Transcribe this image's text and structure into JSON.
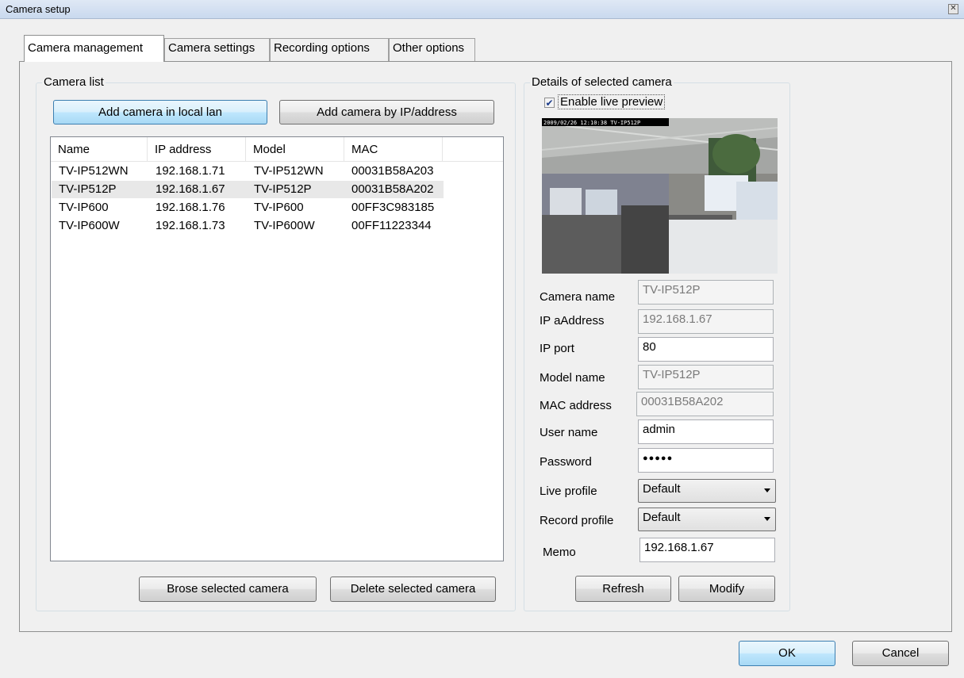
{
  "window": {
    "title": "Camera setup"
  },
  "tabs": [
    "Camera management",
    "Camera settings",
    "Recording options",
    "Other options"
  ],
  "camera_list": {
    "label": "Camera list",
    "add_local_button": "Add camera in local lan",
    "add_ip_button": "Add camera by IP/address",
    "columns": [
      "Name",
      "IP address",
      "Model",
      "MAC"
    ],
    "rows": [
      [
        "TV-IP512WN",
        "192.168.1.71",
        "TV-IP512WN",
        "00031B58A203"
      ],
      [
        "TV-IP512P",
        "192.168.1.67",
        "TV-IP512P",
        "00031B58A202"
      ],
      [
        "TV-IP600",
        "192.168.1.76",
        "TV-IP600",
        "00FF3C983185"
      ],
      [
        "TV-IP600W",
        "192.168.1.73",
        "TV-IP600W",
        "00FF11223344"
      ]
    ],
    "selected_row": 1,
    "browse_button": "Brose selected camera",
    "delete_button": "Delete selected camera"
  },
  "details": {
    "label": "Details of selected camera",
    "live_preview_label": "Enable live preview",
    "live_preview_checked": true,
    "preview_timestamp": "2009/02/26 12:10:38 TV-IP512P",
    "fields": {
      "camera_name": {
        "label": "Camera name",
        "value": "TV-IP512P"
      },
      "ip_address": {
        "label": "IP aAddress",
        "value": "192.168.1.67"
      },
      "ip_port": {
        "label": "IP port",
        "value": "80"
      },
      "model_name": {
        "label": "Model name",
        "value": "TV-IP512P"
      },
      "mac_address": {
        "label": "MAC address",
        "value": "00031B58A202"
      },
      "user_name": {
        "label": "User name",
        "value": "admin"
      },
      "password": {
        "label": "Password",
        "value": "●●●●●"
      },
      "live_profile": {
        "label": "Live profile",
        "value": "Default"
      },
      "record_profile": {
        "label": "Record profile",
        "value": "Default"
      },
      "memo": {
        "label": "Memo",
        "value": "192.168.1.67"
      }
    },
    "refresh_button": "Refresh",
    "modify_button": "Modify"
  },
  "dialog_buttons": {
    "ok": "OK",
    "cancel": "Cancel"
  }
}
